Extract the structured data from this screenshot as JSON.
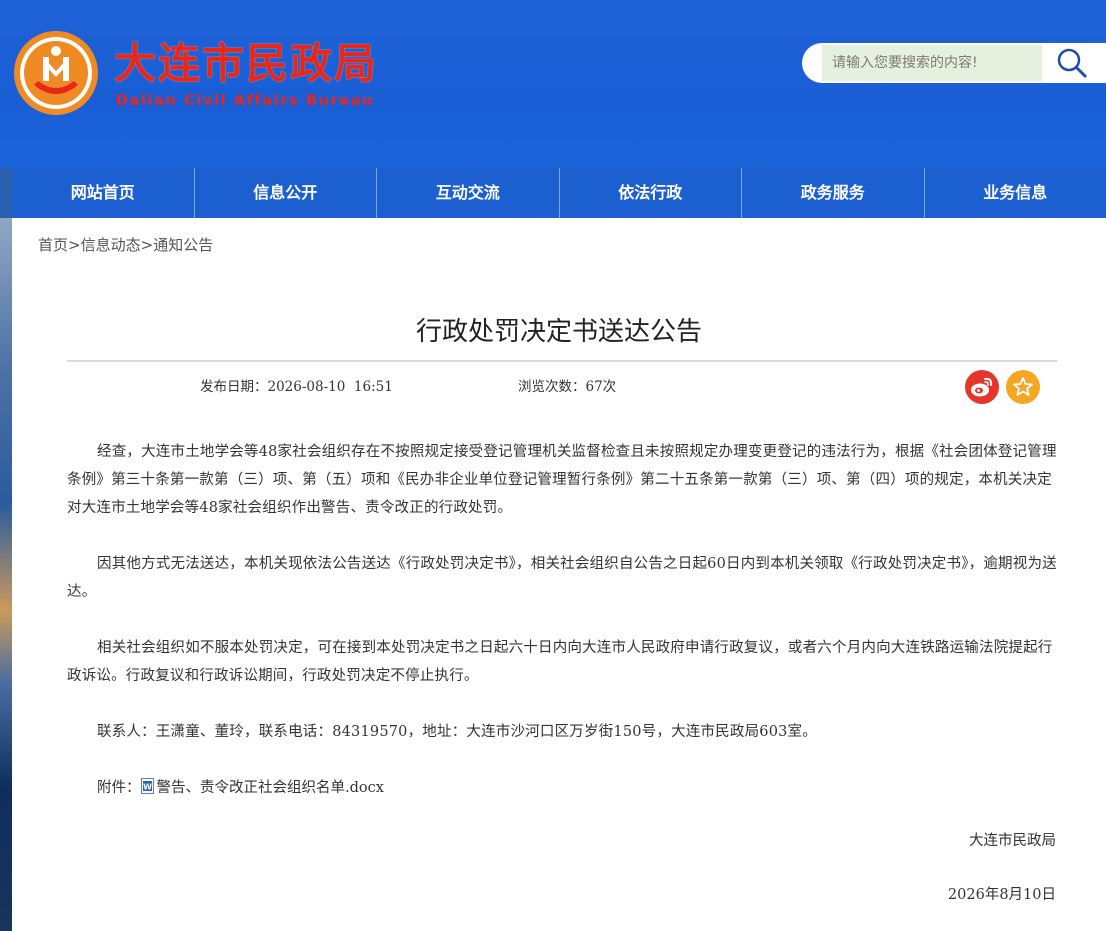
{
  "header": {
    "title_cn": "大连市民政局",
    "title_en": "Dalian Civil Affairs Bureau",
    "logo_icon": "civil-affairs-emblem-icon"
  },
  "search": {
    "placeholder": "请输入您要搜索的内容!",
    "button_icon": "search-icon"
  },
  "nav": {
    "items": [
      "网站首页",
      "信息公开",
      "互动交流",
      "依法行政",
      "政务服务",
      "业务信息"
    ]
  },
  "breadcrumb": {
    "items": [
      "首页",
      "信息动态",
      "通知公告"
    ],
    "separator": ">"
  },
  "article": {
    "title": "行政处罚决定书送达公告",
    "publish_label": "发布日期：",
    "publish_date": "2026-08-10  16:51",
    "views_label": "浏览次数：",
    "views_value": "67次",
    "share_weibo_icon": "weibo-icon",
    "favorite_icon": "star-icon",
    "paragraphs": [
      "经查，大连市土地学会等48家社会组织存在不按照规定接受登记管理机关监督检查且未按照规定办理变更登记的违法行为，根据《社会团体登记管理条例》第三十条第一款第（三）项、第（五）项和《民办非企业单位登记管理暂行条例》第二十五条第一款第（三）项、第（四）项的规定，本机关决定对大连市土地学会等48家社会组织作出警告、责令改正的行政处罚。",
      "因其他方式无法送达，本机关现依法公告送达《行政处罚决定书》，相关社会组织自公告之日起60日内到本机关领取《行政处罚决定书》，逾期视为送达。",
      "相关社会组织如不服本处罚决定，可在接到本处罚决定书之日起六十日内向大连市人民政府申请行政复议，或者六个月内向大连铁路运输法院提起行政诉讼。行政复议和行政诉讼期间，行政处罚决定不停止执行。",
      "联系人：王潇童、董玲，联系电话：84319570，地址：大连市沙河口区万岁街150号，大连市民政局603室。"
    ],
    "attachment_label": "附件：",
    "attachment_icon": "word-doc-icon",
    "attachment_name": "警告、责令改正社会组织名单.docx",
    "sign_org": "大连市民政局",
    "sign_date": "2026年8月10日"
  },
  "colors": {
    "header_blue": "#1f62d6",
    "nav_blue": "#1c5fd0",
    "logo_red": "#e8261a",
    "weibo_red": "#e6352a",
    "favorite_orange": "#f5a623"
  }
}
